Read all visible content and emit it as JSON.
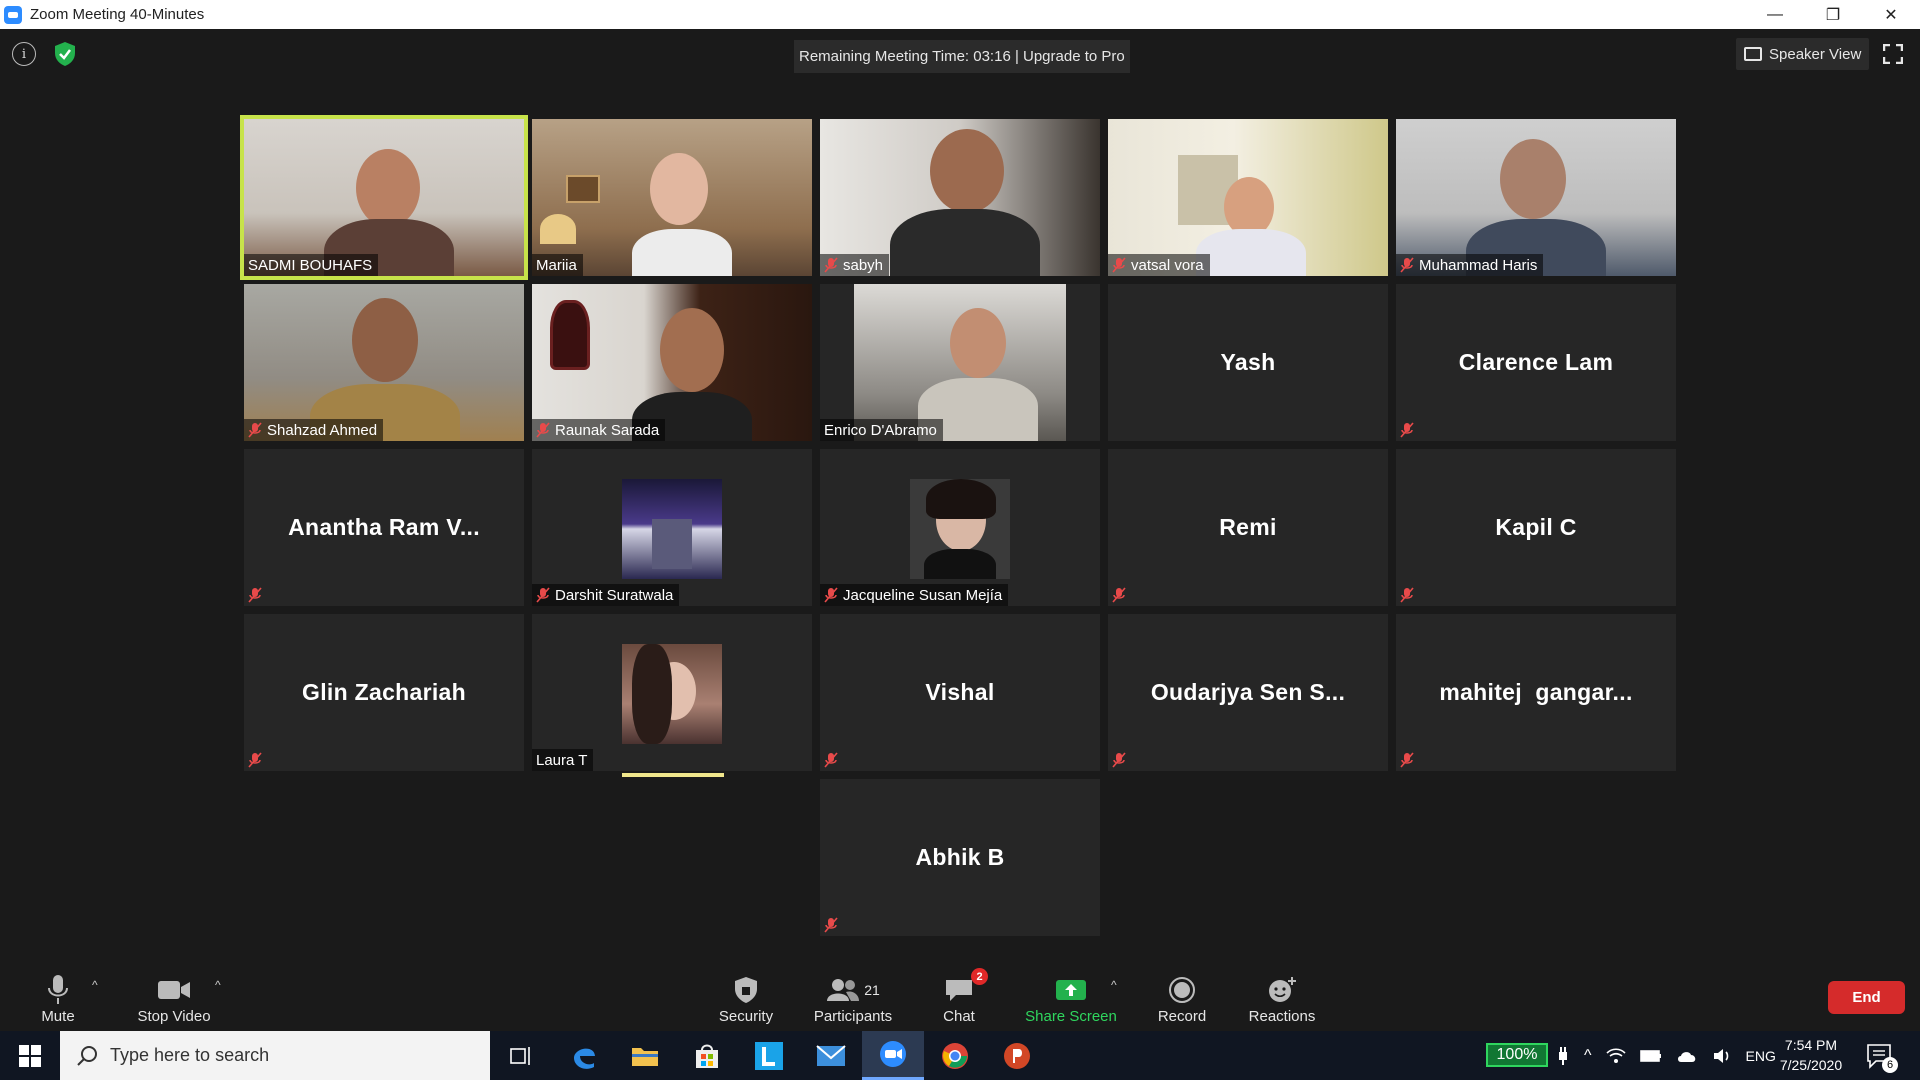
{
  "window": {
    "title": "Zoom Meeting 40-Minutes",
    "minimize": "—",
    "restore": "❐",
    "close": "✕"
  },
  "meeting": {
    "remaining_text": "Remaining Meeting Time: 03:16 | Upgrade to Pro",
    "speaker_view": "Speaker View"
  },
  "participants": [
    {
      "name": "SADMI BOUHAFS",
      "video": true,
      "muted": false,
      "active": true
    },
    {
      "name": "Mariia",
      "video": true,
      "muted": false
    },
    {
      "name": "sabyh",
      "video": true,
      "muted": true
    },
    {
      "name": "vatsal vora",
      "video": true,
      "muted": true
    },
    {
      "name": "Muhammad Haris",
      "video": true,
      "muted": true
    },
    {
      "name": "Shahzad Ahmed",
      "video": true,
      "muted": true
    },
    {
      "name": "Raunak Sarada",
      "video": true,
      "muted": true
    },
    {
      "name": "Enrico D'Abramo",
      "video": true,
      "muted": false
    },
    {
      "name": "Yash",
      "video": false,
      "muted": false
    },
    {
      "name": "Clarence Lam",
      "video": false,
      "muted": true
    },
    {
      "name": "Anantha Ram V...",
      "video": false,
      "muted": true
    },
    {
      "name": "Darshit Suratwala",
      "video": false,
      "avatar": true,
      "muted": true
    },
    {
      "name": "Jacqueline Susan Mejía",
      "video": false,
      "avatar": true,
      "muted": true
    },
    {
      "name": "Remi",
      "video": false,
      "muted": true
    },
    {
      "name": "Kapil C",
      "video": false,
      "muted": true
    },
    {
      "name": "Glin Zachariah",
      "video": false,
      "muted": true
    },
    {
      "name": "Laura T",
      "video": false,
      "avatar": true,
      "muted": false
    },
    {
      "name": "Vishal",
      "video": false,
      "muted": true
    },
    {
      "name": "Oudarjya Sen S...",
      "video": false,
      "muted": true
    },
    {
      "name": "mahitej  gangar...",
      "video": false,
      "muted": true
    },
    {
      "name": "Abhik B",
      "video": false,
      "muted": true
    }
  ],
  "toolbar": {
    "mute": "Mute",
    "stop_video": "Stop Video",
    "security": "Security",
    "participants": "Participants",
    "participants_count": "21",
    "chat": "Chat",
    "chat_badge": "2",
    "share_screen": "Share Screen",
    "record": "Record",
    "reactions": "Reactions",
    "end": "End"
  },
  "taskbar": {
    "search_placeholder": "Type here to search",
    "battery": "100%",
    "language": "ENG",
    "time": "7:54 PM",
    "date": "7/25/2020",
    "notifications": "6"
  },
  "colors": {
    "active_speaker": "#c7e34a",
    "end_button": "#d52b2b",
    "share_green": "#2fd65e",
    "taskbar": "#101622"
  }
}
